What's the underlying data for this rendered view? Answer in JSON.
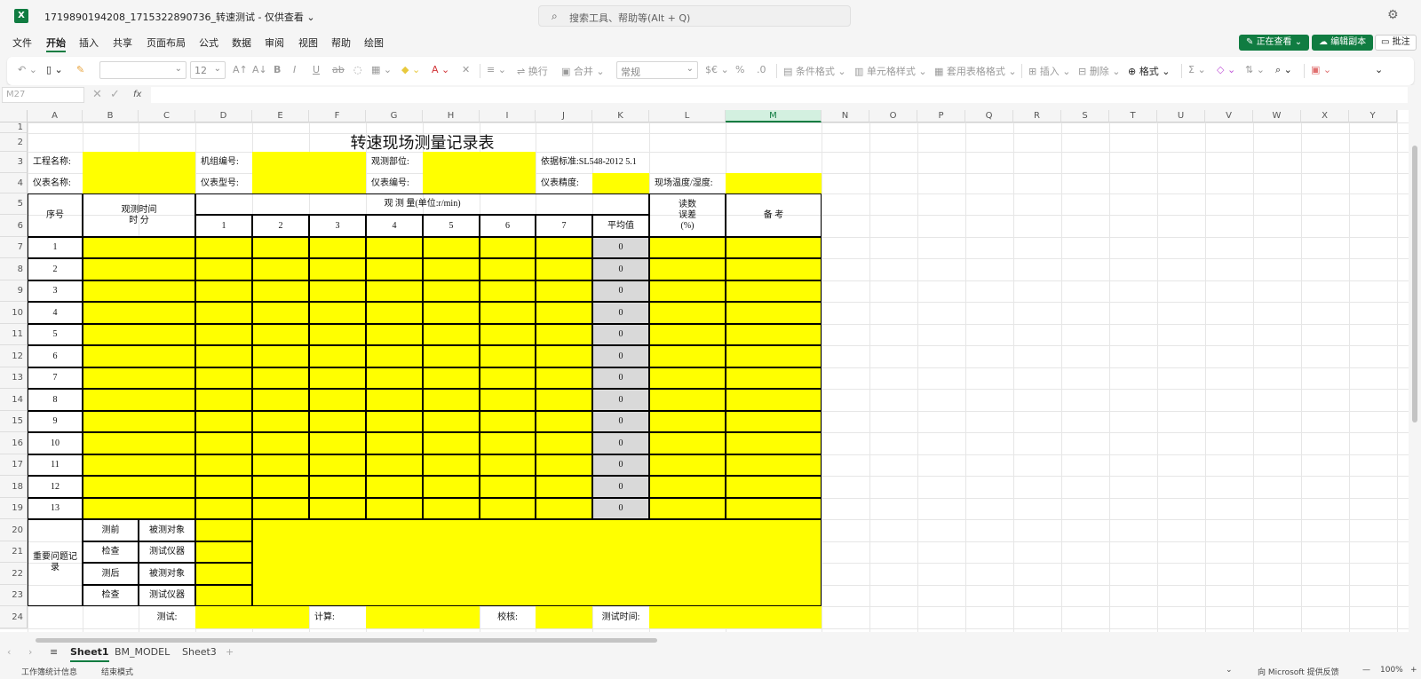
{
  "titlebar": {
    "app_icon": "excel-icon",
    "app_letter": "X",
    "document_title": "1719890194208_1715322890736_转速测试 - 仅供查看",
    "search_placeholder": "搜索工具、帮助等(Alt + Q)",
    "settings_icon": "gear-icon"
  },
  "menu": {
    "items": [
      "文件",
      "开始",
      "插入",
      "共享",
      "页面布局",
      "公式",
      "数据",
      "审阅",
      "视图",
      "帮助",
      "绘图"
    ],
    "active": "开始",
    "viewing_button": "正在查看",
    "edit_copy_button": "编辑副本",
    "comments_button": "批注"
  },
  "ribbon": {
    "font_name": "",
    "font_size": "12",
    "wrap_text": "换行",
    "merge": "合并",
    "number_format": "常规",
    "conditional_format": "条件格式",
    "cell_styles": "单元格样式",
    "table_format": "套用表格格式",
    "insert": "插入",
    "delete": "删除",
    "format": "格式"
  },
  "formula_bar": {
    "name_box": "M27",
    "fx_label": "fx",
    "value": ""
  },
  "grid": {
    "columns": [
      "A",
      "B",
      "C",
      "D",
      "E",
      "F",
      "G",
      "H",
      "I",
      "J",
      "K",
      "L",
      "M",
      "N",
      "O",
      "P",
      "Q",
      "R",
      "S",
      "T",
      "U",
      "V",
      "W",
      "X",
      "Y"
    ],
    "selected_column": "M",
    "rows": [
      "1",
      "2",
      "3",
      "4",
      "5",
      "6",
      "7",
      "8",
      "9",
      "10",
      "11",
      "12",
      "13",
      "14",
      "15",
      "16",
      "17",
      "18",
      "19",
      "20",
      "21",
      "22",
      "23",
      "24"
    ]
  },
  "sheet": {
    "title": "转速现场测量记录表",
    "project_name_label": "工程名称:",
    "unit_number_label": "机组编号:",
    "observe_part_label": "观测部位:",
    "standard_label": "依据标准:SL548-2012 5.1",
    "instrument_name_label": "仪表名称:",
    "instrument_model_label": "仪表型号:",
    "instrument_no_label": "仪表编号:",
    "instrument_accuracy_label": "仪表精度:",
    "temp_humidity_label": "现场温度/湿度:",
    "seq_header": "序号",
    "time_header_line1": "观测时间",
    "time_header_line2": "时  分",
    "measure_header": "观    测    量(单位:r/min)",
    "reading_numbers": [
      "1",
      "2",
      "3",
      "4",
      "5",
      "6",
      "7"
    ],
    "average_header": "平均值",
    "error_header_line1": "读数",
    "error_header_line2": "误差",
    "error_header_line3": "(%)",
    "remark_header": "备  考",
    "data_rows": [
      {
        "seq": "1",
        "avg": "0"
      },
      {
        "seq": "2",
        "avg": "0"
      },
      {
        "seq": "3",
        "avg": "0"
      },
      {
        "seq": "4",
        "avg": "0"
      },
      {
        "seq": "5",
        "avg": "0"
      },
      {
        "seq": "6",
        "avg": "0"
      },
      {
        "seq": "7",
        "avg": "0"
      },
      {
        "seq": "8",
        "avg": "0"
      },
      {
        "seq": "9",
        "avg": "0"
      },
      {
        "seq": "10",
        "avg": "0"
      },
      {
        "seq": "11",
        "avg": "0"
      },
      {
        "seq": "12",
        "avg": "0"
      },
      {
        "seq": "13",
        "avg": "0"
      }
    ],
    "issues_label_line1": "重要问题记",
    "issues_label_line2": "录",
    "before_label": "测前",
    "after_label": "测后",
    "check_label": "检查",
    "measured_object_label": "被测对象",
    "test_instrument_label": "测试仪器",
    "tester_label": "测试:",
    "calc_label": "计算:",
    "verify_label": "校核:",
    "test_time_label": "测试时间:"
  },
  "sheet_tabs": [
    "Sheet1",
    "BM_MODEL",
    "Sheet3"
  ],
  "active_sheet": "Sheet1",
  "status": {
    "workbook_stats": "工作簿统计信息",
    "end_mode": "结束模式",
    "feedback": "向 Microsoft 提供反馈",
    "zoom": "100%"
  }
}
